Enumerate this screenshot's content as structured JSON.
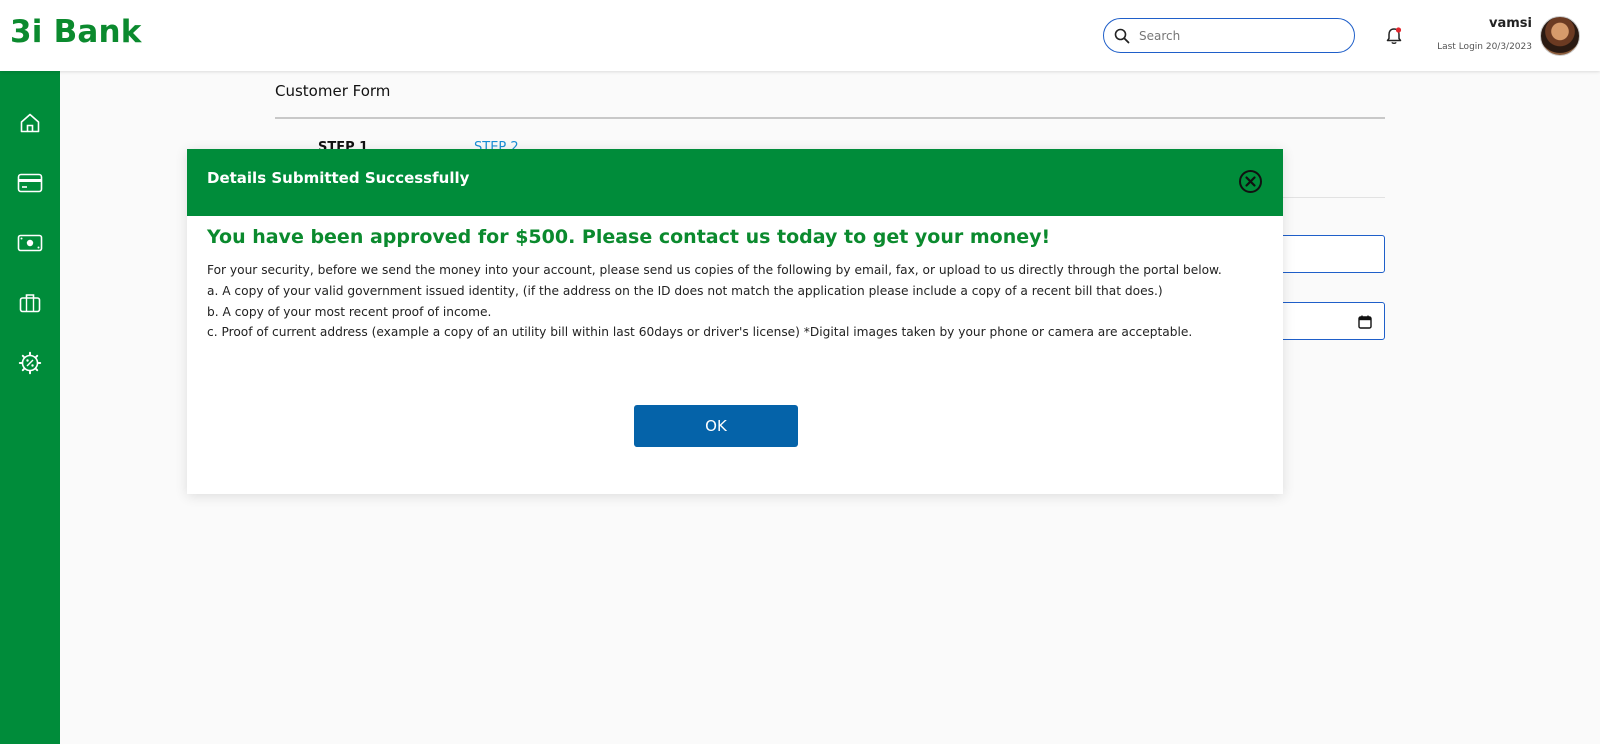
{
  "header": {
    "logo": "3i Bank",
    "search_placeholder": "Search",
    "user_name": "vamsi",
    "last_login": "Last Login 20/3/2023"
  },
  "sidebar": {
    "items": [
      {
        "icon": "home-icon"
      },
      {
        "icon": "card-icon"
      },
      {
        "icon": "cash-icon"
      },
      {
        "icon": "briefcase-icon"
      },
      {
        "icon": "percent-badge-icon"
      }
    ]
  },
  "form": {
    "title": "Customer Form",
    "step1": "STEP 1",
    "step2": "STEP 2"
  },
  "modal": {
    "title": "Details Submitted Successfully",
    "headline": "You have been approved for $500. Please contact us today to get your money!",
    "lines": [
      "For your security, before we send the money into your account, please send us copies of the following by email, fax, or upload to us directly through the portal below.",
      "a. A copy of your valid government issued identity, (if the address on the ID does not match the application please include a copy of a recent bill that does.)",
      "b. A copy of your most recent proof of income.",
      "c. Proof of current address (example a copy of an utility bill within last 60days or driver's license) *Digital images taken by your phone or camera are acceptable."
    ],
    "ok_label": "OK"
  },
  "colors": {
    "brand_green": "#008c3a",
    "headline_green": "#0b8a2e",
    "ok_blue": "#0563a9",
    "input_border": "#1f5fc9"
  }
}
